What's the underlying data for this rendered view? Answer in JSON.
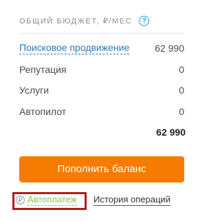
{
  "header": {
    "title": "ОБЩИЙ БЮДЖЕТ, ₽/МЕС",
    "help": "?"
  },
  "rows": [
    {
      "label": "Поисковое продвижение",
      "value": "62 990"
    },
    {
      "label": "Репутация",
      "value": "0"
    },
    {
      "label": "Услуги",
      "value": "0"
    },
    {
      "label": "Автопилот",
      "value": "0"
    }
  ],
  "total": "62 990",
  "button": {
    "label": "Пополнить баланс"
  },
  "links": {
    "autopay": "Автоплатеж",
    "history": "История операций"
  },
  "colors": {
    "button": "#f57c00",
    "link": "#1f7bc6",
    "autopay": "#8bc34a",
    "highlight": "#b11a1f"
  }
}
